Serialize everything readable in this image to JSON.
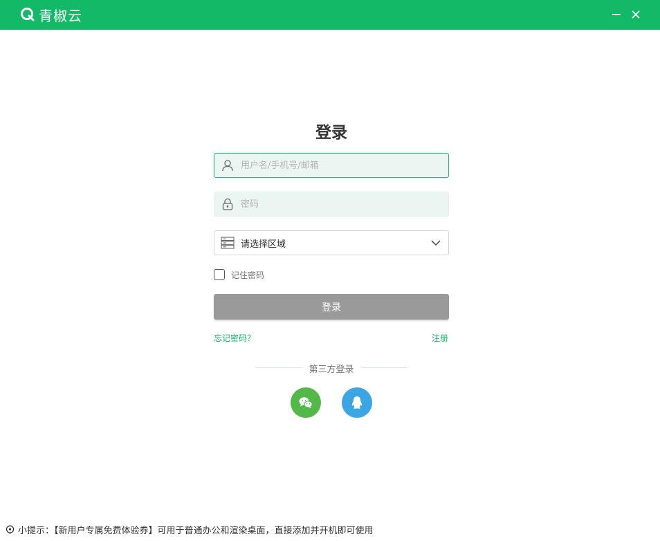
{
  "app": {
    "name": "青椒云",
    "brand_color": "#12b967"
  },
  "window": {
    "minimize_icon": "minimize-icon",
    "close_icon": "close-icon"
  },
  "login": {
    "title": "登录",
    "username_placeholder": "用户名/手机号/邮箱",
    "username_value": "",
    "password_placeholder": "密码",
    "password_value": "",
    "region_selected": "请选择区域",
    "remember_label": "记住密码",
    "remember_checked": false,
    "submit_label": "登录",
    "submit_color": "#9a9a9a",
    "forgot_label": "忘记密码？",
    "register_label": "注册"
  },
  "third_party": {
    "label": "第三方登录",
    "providers": [
      {
        "icon": "wechat-icon",
        "color": "#52b848"
      },
      {
        "icon": "qq-icon",
        "color": "#3ba6e3"
      }
    ]
  },
  "tip": {
    "text": "小提示：【新用户专属免费体验券】可用于普通办公和渲染桌面，直接添加并开机即可使用"
  }
}
